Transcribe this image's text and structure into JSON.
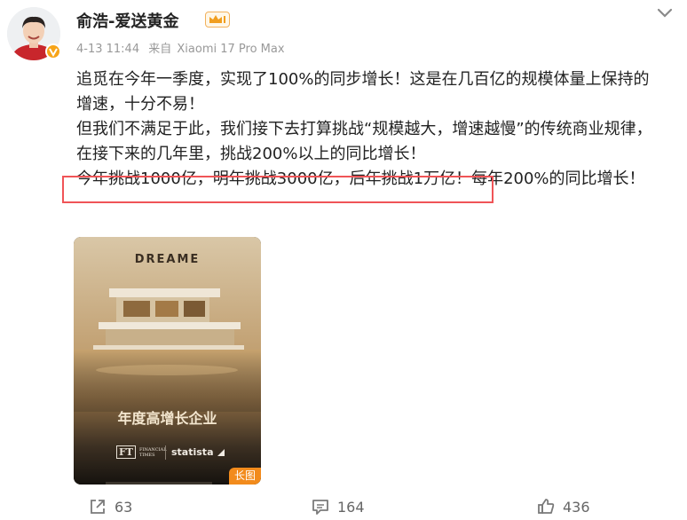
{
  "post": {
    "author_name": "俞浩-爱送黄金",
    "timestamp": "4-13 11:44",
    "source_prefix": "来自",
    "device": "Xiaomi 17 Pro Max",
    "lines": [
      "追觅在今年一季度，实现了100%的同步增长！这是在几百亿的规模体量上保持的",
      "增速，十分不易！",
      "但我们不满足于此，我们接下去打算挑战“规模越大，增速越慢”的传统商业规律，",
      "在接下来的几年里，挑战200%以上的同比增长！",
      "今年挑战1000亿，明年挑战3000亿，后年挑战1万亿！每年200%的同比增长！"
    ]
  },
  "poster": {
    "brand": "DREAME",
    "headline": "年度高增长企业",
    "ft_logo": "FT",
    "ft_text_1": "FINANCIAL",
    "ft_text_2": "TIMES",
    "statista": "statista",
    "badge": "长图"
  },
  "actions": {
    "repost_count": "63",
    "comment_count": "164",
    "like_count": "436"
  },
  "colors": {
    "highlight_border": "#f05457",
    "vip_badge": "#f7a418",
    "long_image_badge": "#f28b1c"
  },
  "icons": [
    "avatar",
    "verified-v-icon",
    "crown-badge-icon",
    "chevron-down-icon",
    "repost-icon",
    "comment-icon",
    "like-icon"
  ]
}
